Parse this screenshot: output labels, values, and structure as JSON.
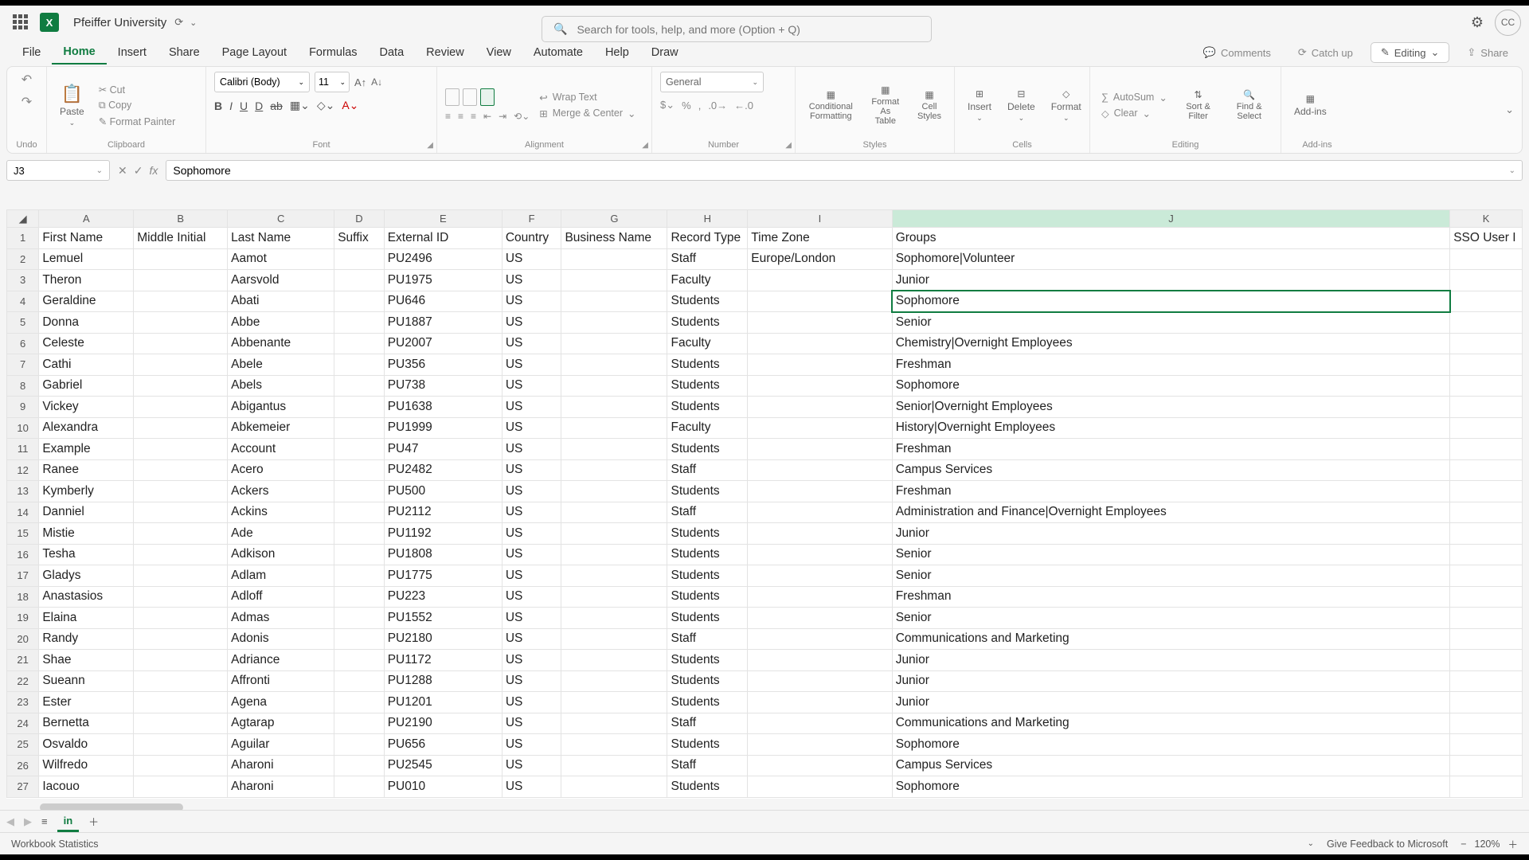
{
  "title": "Pfeiffer University",
  "search_placeholder": "Search for tools, help, and more (Option + Q)",
  "avatar": "CC",
  "menu": [
    "File",
    "Home",
    "Insert",
    "Share",
    "Page Layout",
    "Formulas",
    "Data",
    "Review",
    "View",
    "Automate",
    "Help",
    "Draw"
  ],
  "menu_active": 1,
  "menu_right": {
    "comments": "Comments",
    "catchup": "Catch up",
    "editing": "Editing",
    "share": "Share"
  },
  "ribbon": {
    "undo": "Undo",
    "paste": "Paste",
    "clipboard_items": [
      "Cut",
      "Copy",
      "Format Painter"
    ],
    "clipboard": "Clipboard",
    "font_name": "Calibri (Body)",
    "font_size": "11",
    "font": "Font",
    "wrap": "Wrap Text",
    "merge": "Merge & Center",
    "alignment": "Alignment",
    "number_format": "General",
    "number": "Number",
    "cond": "Conditional Formatting",
    "fmt_table": "Format As Table",
    "cell_styles": "Cell Styles",
    "styles": "Styles",
    "insert": "Insert",
    "delete": "Delete",
    "format": "Format",
    "cells": "Cells",
    "autosum": "AutoSum",
    "clear": "Clear",
    "sort": "Sort & Filter",
    "find": "Find & Select",
    "editing": "Editing",
    "addins": "Add-ins",
    "addins_lbl": "Add-ins"
  },
  "namebox": "J3",
  "formula": "Sophomore",
  "columns": [
    "A",
    "B",
    "C",
    "D",
    "E",
    "F",
    "G",
    "H",
    "I",
    "J",
    "K"
  ],
  "col_selected": "J",
  "headers": [
    "First Name",
    "Middle Initial",
    "Last Name",
    "Suffix",
    "External ID",
    "Country",
    "Business Name",
    "Record Type",
    "Time Zone",
    "Groups",
    "SSO User I"
  ],
  "selected_cell": {
    "row": 4,
    "col": 10
  },
  "rows": [
    {
      "n": 2,
      "c": [
        "Lemuel",
        "",
        "Aamot",
        "",
        "PU2496",
        "US",
        "",
        "Staff",
        "Europe/London",
        "Sophomore|Volunteer",
        ""
      ]
    },
    {
      "n": 3,
      "c": [
        "Theron",
        "",
        "Aarsvold",
        "",
        "PU1975",
        "US",
        "",
        "Faculty",
        "",
        "Junior",
        ""
      ]
    },
    {
      "n": 4,
      "c": [
        "Geraldine",
        "",
        "Abati",
        "",
        "PU646",
        "US",
        "",
        "Students",
        "",
        "Sophomore",
        ""
      ]
    },
    {
      "n": 5,
      "c": [
        "Donna",
        "",
        "Abbe",
        "",
        "PU1887",
        "US",
        "",
        "Students",
        "",
        "Senior",
        ""
      ]
    },
    {
      "n": 6,
      "c": [
        "Celeste",
        "",
        "Abbenante",
        "",
        "PU2007",
        "US",
        "",
        "Faculty",
        "",
        "Chemistry|Overnight Employees",
        ""
      ]
    },
    {
      "n": 7,
      "c": [
        "Cathi",
        "",
        "Abele",
        "",
        "PU356",
        "US",
        "",
        "Students",
        "",
        "Freshman",
        ""
      ]
    },
    {
      "n": 8,
      "c": [
        "Gabriel",
        "",
        "Abels",
        "",
        "PU738",
        "US",
        "",
        "Students",
        "",
        "Sophomore",
        ""
      ]
    },
    {
      "n": 9,
      "c": [
        "Vickey",
        "",
        "Abigantus",
        "",
        "PU1638",
        "US",
        "",
        "Students",
        "",
        "Senior|Overnight Employees",
        ""
      ]
    },
    {
      "n": 10,
      "c": [
        "Alexandra",
        "",
        "Abkemeier",
        "",
        "PU1999",
        "US",
        "",
        "Faculty",
        "",
        "History|Overnight Employees",
        ""
      ]
    },
    {
      "n": 11,
      "c": [
        "Example",
        "",
        "Account",
        "",
        "PU47",
        "US",
        "",
        "Students",
        "",
        "Freshman",
        ""
      ]
    },
    {
      "n": 12,
      "c": [
        "Ranee",
        "",
        "Acero",
        "",
        "PU2482",
        "US",
        "",
        "Staff",
        "",
        "Campus Services",
        ""
      ]
    },
    {
      "n": 13,
      "c": [
        "Kymberly",
        "",
        "Ackers",
        "",
        "PU500",
        "US",
        "",
        "Students",
        "",
        "Freshman",
        ""
      ]
    },
    {
      "n": 14,
      "c": [
        "Danniel",
        "",
        "Ackins",
        "",
        "PU2112",
        "US",
        "",
        "Staff",
        "",
        "Administration and Finance|Overnight Employees",
        ""
      ]
    },
    {
      "n": 15,
      "c": [
        "Mistie",
        "",
        "Ade",
        "",
        "PU1192",
        "US",
        "",
        "Students",
        "",
        "Junior",
        ""
      ]
    },
    {
      "n": 16,
      "c": [
        "Tesha",
        "",
        "Adkison",
        "",
        "PU1808",
        "US",
        "",
        "Students",
        "",
        "Senior",
        ""
      ]
    },
    {
      "n": 17,
      "c": [
        "Gladys",
        "",
        "Adlam",
        "",
        "PU1775",
        "US",
        "",
        "Students",
        "",
        "Senior",
        ""
      ]
    },
    {
      "n": 18,
      "c": [
        "Anastasios",
        "",
        "Adloff",
        "",
        "PU223",
        "US",
        "",
        "Students",
        "",
        "Freshman",
        ""
      ]
    },
    {
      "n": 19,
      "c": [
        "Elaina",
        "",
        "Admas",
        "",
        "PU1552",
        "US",
        "",
        "Students",
        "",
        "Senior",
        ""
      ]
    },
    {
      "n": 20,
      "c": [
        "Randy",
        "",
        "Adonis",
        "",
        "PU2180",
        "US",
        "",
        "Staff",
        "",
        "Communications and Marketing",
        ""
      ]
    },
    {
      "n": 21,
      "c": [
        "Shae",
        "",
        "Adriance",
        "",
        "PU1172",
        "US",
        "",
        "Students",
        "",
        "Junior",
        ""
      ]
    },
    {
      "n": 22,
      "c": [
        "Sueann",
        "",
        "Affronti",
        "",
        "PU1288",
        "US",
        "",
        "Students",
        "",
        "Junior",
        ""
      ]
    },
    {
      "n": 23,
      "c": [
        "Ester",
        "",
        "Agena",
        "",
        "PU1201",
        "US",
        "",
        "Students",
        "",
        "Junior",
        ""
      ]
    },
    {
      "n": 24,
      "c": [
        "Bernetta",
        "",
        "Agtarap",
        "",
        "PU2190",
        "US",
        "",
        "Staff",
        "",
        "Communications and Marketing",
        ""
      ]
    },
    {
      "n": 25,
      "c": [
        "Osvaldo",
        "",
        "Aguilar",
        "",
        "PU656",
        "US",
        "",
        "Students",
        "",
        "Sophomore",
        ""
      ]
    },
    {
      "n": 26,
      "c": [
        "Wilfredo",
        "",
        "Aharoni",
        "",
        "PU2545",
        "US",
        "",
        "Staff",
        "",
        "Campus Services",
        ""
      ]
    },
    {
      "n": 27,
      "c": [
        "Iacouo",
        "",
        "Aharoni",
        "",
        "PU010",
        "US",
        "",
        "Students",
        "",
        "Sophomore",
        ""
      ]
    }
  ],
  "sheet_tab": "in",
  "status_left": "Workbook Statistics",
  "status_feedback": "Give Feedback to Microsoft",
  "zoom": "120%"
}
